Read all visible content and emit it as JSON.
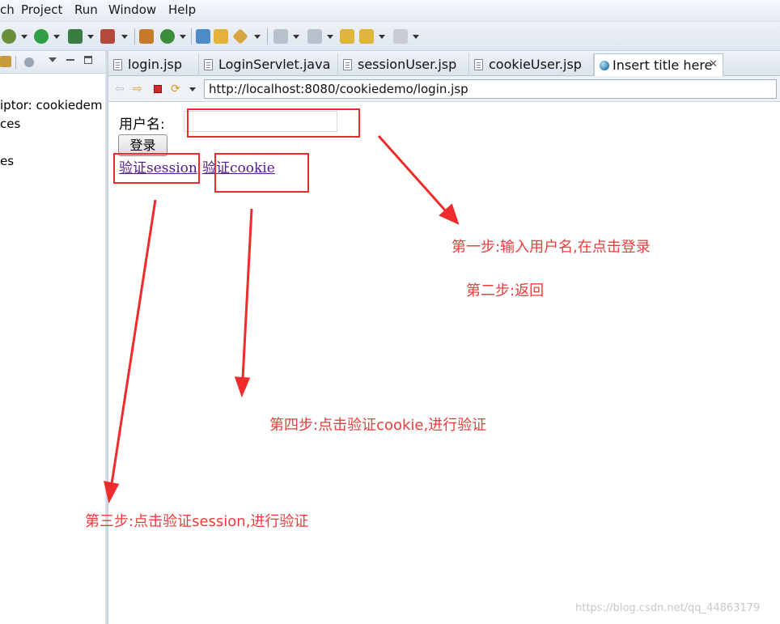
{
  "menubar": {
    "items": [
      "ch",
      "Project",
      "Run",
      "Window",
      "Help"
    ]
  },
  "left_view": {
    "tree_items": [
      "iptor: cookiedem",
      "ces",
      "es"
    ]
  },
  "editor_tabs": [
    {
      "label": "login.jsp",
      "icon": "jsp-file-icon"
    },
    {
      "label": "LoginServlet.java",
      "icon": "java-file-icon"
    },
    {
      "label": "sessionUser.jsp",
      "icon": "jsp-file-icon"
    },
    {
      "label": "cookieUser.jsp",
      "icon": "jsp-file-icon"
    },
    {
      "label": "Insert title here",
      "icon": "globe-icon",
      "active": true
    }
  ],
  "browser": {
    "url": "http://localhost:8080/cookiedemo/login.jsp"
  },
  "page": {
    "username_label": "用户名:",
    "username_value": "",
    "login_button": "登录",
    "link_session": "验证session",
    "link_cookie": "验证cookie"
  },
  "annotations": {
    "step1": "第一步:输入用户名,在点击登录",
    "step2": "第二步:返回",
    "step3": "第三步:点击验证session,进行验证",
    "step4": "第四步:点击验证cookie,进行验证"
  },
  "watermark": "https://blog.csdn.net/qq_44863179",
  "colors": {
    "annotation_red": "#ee2c2c",
    "visited_link": "#551a8b"
  }
}
